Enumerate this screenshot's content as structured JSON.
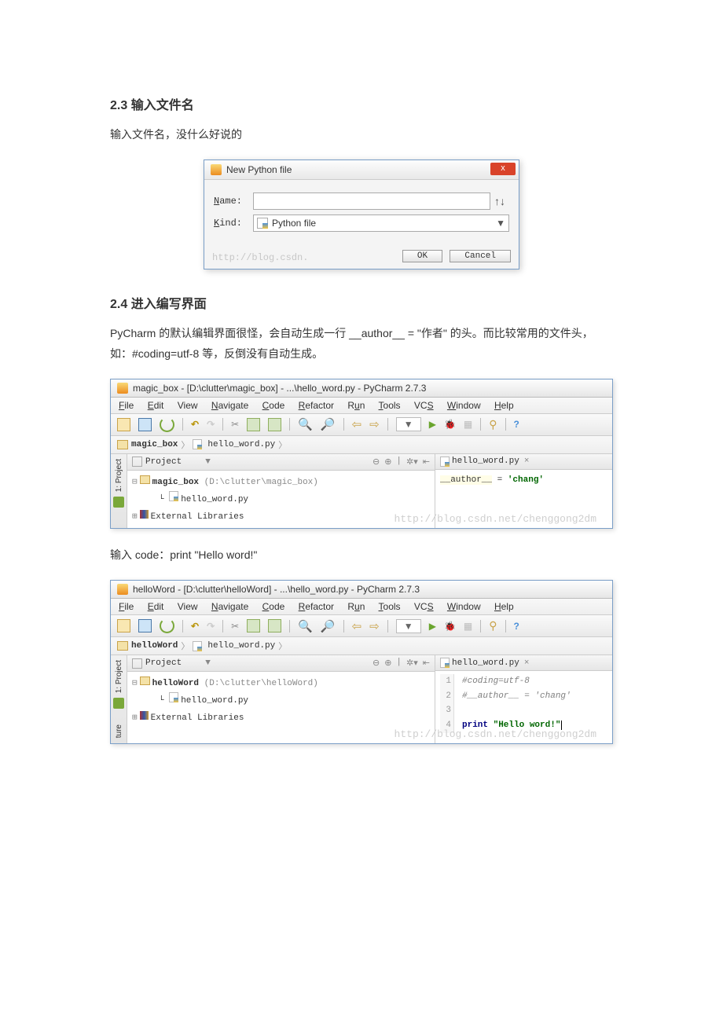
{
  "sections": {
    "s23_title": "2.3  输入文件名",
    "s23_text": "输入文件名，没什么好说的",
    "s24_title": "2.4  进入编写界面",
    "s24_text": "PyCharm 的默认编辑界面很怪，会自动生成一行  __author__  = \"作者\" 的头。而比较常用的文件头，如：#coding=utf-8  等，反倒没有自动生成。",
    "code_text": "输入 code：print \"Hello word!\""
  },
  "dialog": {
    "title": "New Python file",
    "name_label": "Name:",
    "kind_label": "Kind:",
    "kind_value": "Python file",
    "ok": "OK",
    "cancel": "Cancel",
    "watermark": "http://blog.csdn."
  },
  "menu": {
    "file": "File",
    "edit": "Edit",
    "view": "View",
    "nav": "Navigate",
    "code": "Code",
    "ref": "Refactor",
    "run": "Run",
    "tools": "Tools",
    "vcs": "VCS",
    "win": "Window",
    "help": "Help"
  },
  "ide1": {
    "title": "magic_box - [D:\\clutter\\magic_box] - ...\\hello_word.py - PyCharm 2.7.3",
    "bc_root": "magic_box",
    "bc_file": "hello_word.py",
    "proj_label": "Project",
    "tree_root": "magic_box",
    "tree_root_path": " (D:\\clutter\\magic_box)",
    "tree_file": "hello_word.py",
    "tree_ext": "External Libraries",
    "tab_file": "hello_word.py",
    "code_line": "__author__ = 'chang'",
    "watermark": "http://blog.csdn.net/chenggong2dm"
  },
  "ide2": {
    "title": "helloWord - [D:\\clutter\\helloWord] - ...\\hello_word.py - PyCharm 2.7.3",
    "bc_root": "helloWord",
    "bc_file": "hello_word.py",
    "proj_label": "Project",
    "tree_root": "helloWord",
    "tree_root_path": " (D:\\clutter\\helloWord)",
    "tree_file": "hello_word.py",
    "tree_ext": "External Libraries",
    "tab_file": "hello_word.py",
    "lines": {
      "l1": "#coding=utf-8",
      "l2": "#__author__ = 'chang'",
      "l3": "",
      "l4a": "print ",
      "l4b": "\"Hello word!\""
    },
    "watermark": "http://blog.csdn.net/chenggong2dm",
    "side_ture": "ture"
  },
  "side_proj": "1: Project"
}
